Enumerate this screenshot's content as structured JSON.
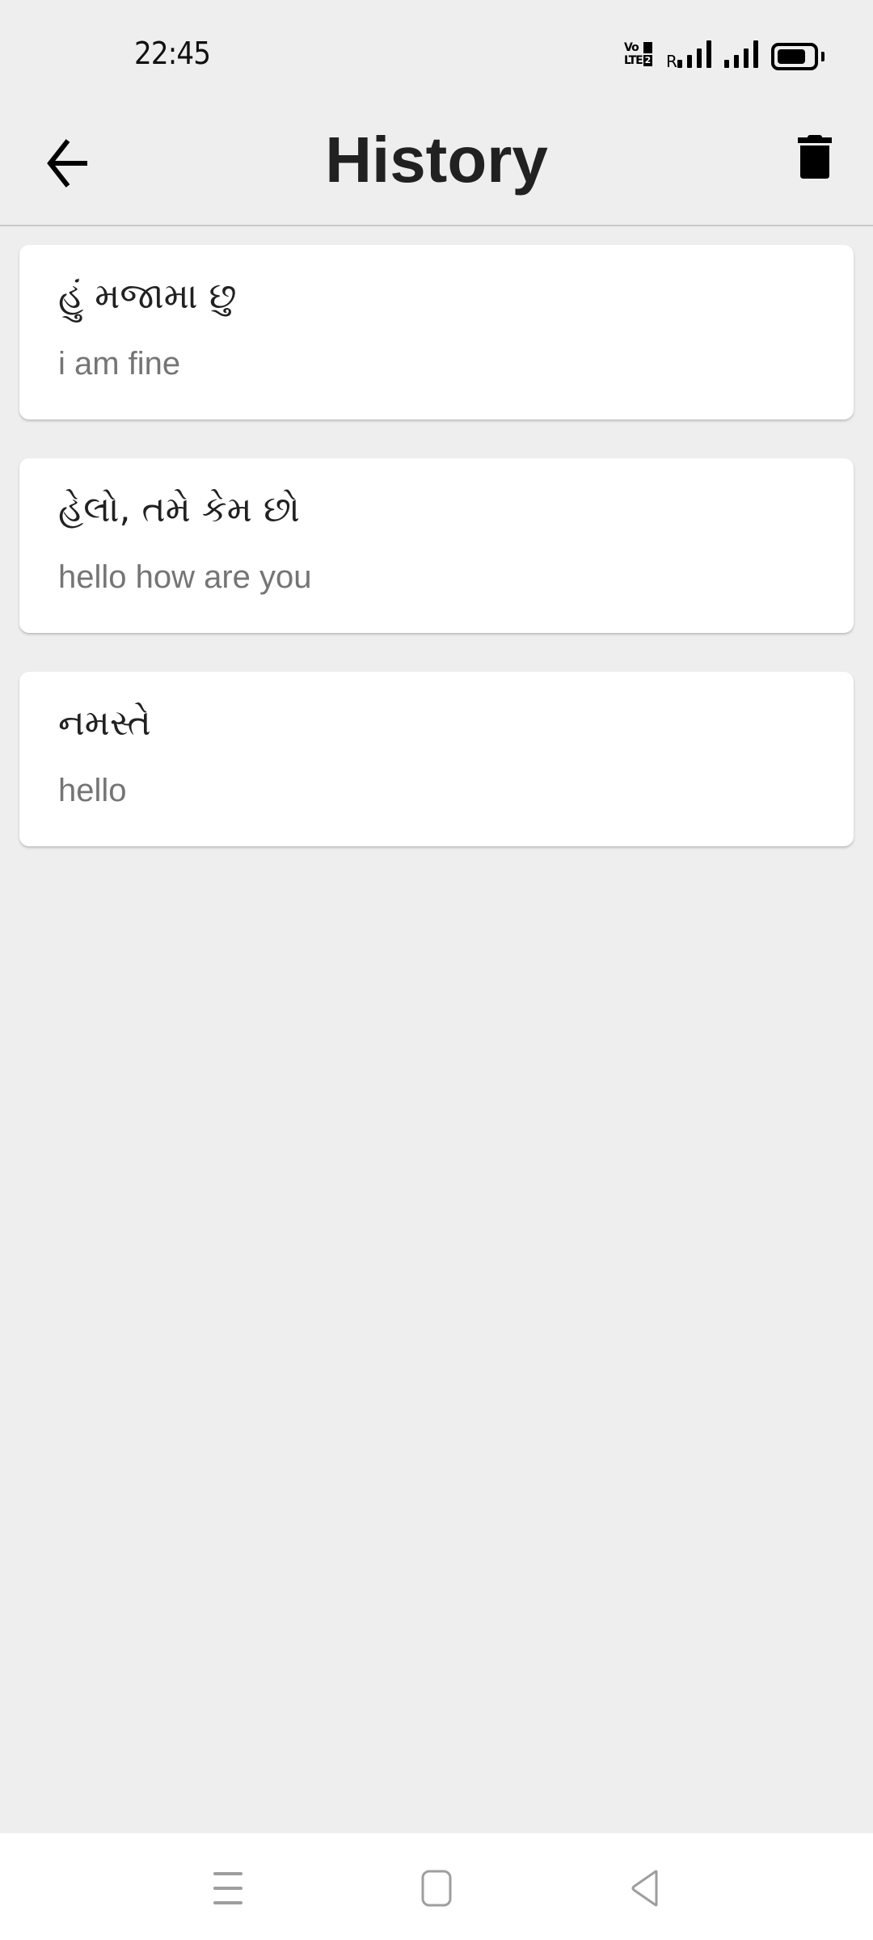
{
  "status_bar": {
    "time": "22:45",
    "network_label_top": "Vo",
    "network_label_bottom": "LTE",
    "sim1_indicator": "1",
    "sim2_indicator": "2",
    "roaming_indicator": "R",
    "battery_level_percent": 80,
    "icons": [
      "volte-icon",
      "signal-sim1-icon",
      "signal-sim2-icon",
      "battery-icon"
    ]
  },
  "app_bar": {
    "title": "History",
    "back_icon": "arrow-left-icon",
    "delete_icon": "trash-icon"
  },
  "history": {
    "items": [
      {
        "source_text": "હું મજામા છુ",
        "translated_text": "i am fine"
      },
      {
        "source_text": "હેલો, તમે કેમ છો",
        "translated_text": "hello how are you"
      },
      {
        "source_text": "નમસ્તે",
        "translated_text": "hello"
      }
    ]
  },
  "nav_bar": {
    "buttons": [
      "menu-icon",
      "home-icon",
      "back-triangle-icon"
    ]
  },
  "colors": {
    "background": "#eeeeee",
    "card": "#ffffff",
    "title_text": "#212121",
    "secondary_text": "#757575",
    "nav_icon": "#9e9e9e"
  }
}
